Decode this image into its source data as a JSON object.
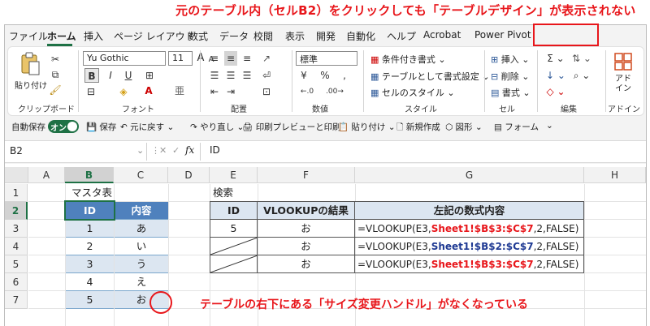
{
  "annotations": {
    "top_note": "元のテーブル内（セルB2）をクリックしても「テーブルデザイン」が表示されない",
    "bottom_note": "テーブルの右下にある「サイズ変更ハンドル」がなくなっている"
  },
  "menu": {
    "tabs": [
      "ファイル",
      "ホーム",
      "挿入",
      "ページ レイアウト",
      "数式",
      "データ",
      "校閲",
      "表示",
      "開発",
      "自動化",
      "ヘルプ",
      "Acrobat",
      "Power Pivot"
    ],
    "active": "ホーム"
  },
  "ribbon": {
    "clipboard": {
      "paste_label": "貼り付け",
      "group_label": "クリップボード"
    },
    "font": {
      "font_name": "Yu Gothic",
      "font_size": "11",
      "bold": "B",
      "italic": "I",
      "underline": "U",
      "grow": "A",
      "shrink": "A",
      "group_label": "フォント"
    },
    "alignment": {
      "group_label": "配置"
    },
    "number": {
      "format": "標準",
      "group_label": "数値"
    },
    "styles": {
      "conditional": "条件付き書式",
      "as_table": "テーブルとして書式設定",
      "cell_styles": "セルのスタイル",
      "group_label": "スタイル"
    },
    "cells": {
      "insert": "挿入",
      "delete": "削除",
      "format": "書式",
      "group_label": "セル"
    },
    "editing": {
      "group_label": "編集"
    },
    "addin": {
      "button_label": "アド イン",
      "group_label": "アドイン"
    }
  },
  "qat": {
    "autosave": "自動保存",
    "toggle": "オン",
    "items": [
      "保存",
      "元に戻す",
      "やり直し",
      "印刷プレビューと印刷",
      "貼り付け",
      "新規作成",
      "図形",
      "フォーム"
    ]
  },
  "formula_bar": {
    "name_box": "B2",
    "fx": "fx",
    "formula": "ID"
  },
  "columns": [
    "A",
    "B",
    "C",
    "D",
    "E",
    "F",
    "G",
    "H"
  ],
  "rows": [
    "1",
    "2",
    "3",
    "4",
    "5",
    "6",
    "7"
  ],
  "selection": {
    "column": "B",
    "row": "2"
  },
  "cells": {
    "B1": "マスタ表",
    "E1": "検索"
  },
  "master_table": {
    "headers": [
      "ID",
      "内容"
    ],
    "rows": [
      [
        "1",
        "あ"
      ],
      [
        "2",
        "い"
      ],
      [
        "3",
        "う"
      ],
      [
        "4",
        "え"
      ],
      [
        "5",
        "お"
      ]
    ]
  },
  "lookup_table": {
    "headers": [
      "ID",
      "VLOOKUPの結果",
      "左記の数式内容"
    ],
    "rows": [
      {
        "id": "5",
        "result": "お",
        "f_prefix": "=VLOOKUP(E3,",
        "f_ref": "Sheet1!$B$3:$C$7",
        "f_suffix": ",2,FALSE)",
        "ref_color": "red"
      },
      {
        "id": "",
        "result": "お",
        "f_prefix": "=VLOOKUP(E3,",
        "f_ref_a": "Sheet1!$B$2",
        "f_ref_b": ":$C$7",
        "f_suffix": ",2,FALSE)",
        "ref_color": "blue"
      },
      {
        "id": "",
        "result": "お",
        "f_prefix": "=VLOOKUP(E3,",
        "f_ref": "Sheet1!$B$3:$C$7",
        "f_suffix": ",2,FALSE)",
        "ref_color": "red"
      }
    ]
  },
  "colors": {
    "excel_green": "#1e7145",
    "table_header": "#4f81bd",
    "table_band": "#dce6f1",
    "annotation_red": "#e8161b",
    "ref_blue": "#1f3a93"
  }
}
